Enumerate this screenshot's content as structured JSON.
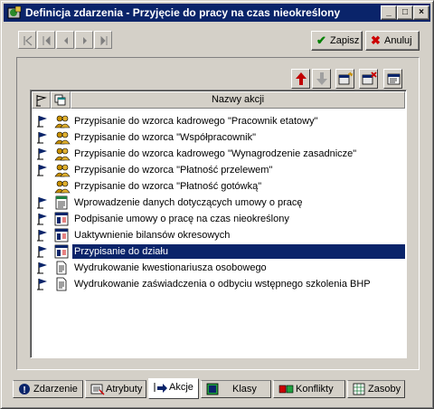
{
  "window": {
    "title": "Definicja zdarzenia - Przyjęcie do pracy na czas nieokreślony",
    "controls": [
      "_",
      "□",
      "×"
    ]
  },
  "toolbar": {
    "nav_buttons": [
      "first",
      "prev-page",
      "prev",
      "next",
      "last"
    ],
    "save_label": "Zapisz",
    "cancel_label": "Anuluj"
  },
  "list": {
    "column_header": "Nazwy akcji",
    "rows": [
      {
        "label": "Przypisanie do wzorca kadrowego \"Pracownik etatowy\"",
        "flag": true,
        "icon": "people-icon",
        "selected": false
      },
      {
        "label": "Przypisanie do wzorca \"Współpracownik\"",
        "flag": true,
        "icon": "people-icon",
        "selected": false
      },
      {
        "label": "Przypisanie do wzorca kadrowego \"Wynagrodzenie zasadnicze\"",
        "flag": true,
        "icon": "people-icon",
        "selected": false
      },
      {
        "label": "Przypisanie do wzorca \"Płatność przelewem\"",
        "flag": true,
        "icon": "people-icon",
        "selected": false
      },
      {
        "label": "Przypisanie do wzorca \"Płatność gotówką\"",
        "flag": false,
        "icon": "people-icon",
        "selected": false
      },
      {
        "label": "Wprowadzenie danych dotyczących umowy o pracę",
        "flag": true,
        "icon": "form-icon",
        "selected": false
      },
      {
        "label": "Podpisanie umowy o pracę na czas nieokreślony",
        "flag": true,
        "icon": "info-window-icon",
        "selected": false
      },
      {
        "label": "Uaktywnienie bilansów okresowych",
        "flag": true,
        "icon": "info-window-icon",
        "selected": false
      },
      {
        "label": "Przypisanie do działu",
        "flag": true,
        "icon": "info-window-icon",
        "selected": true
      },
      {
        "label": "Wydrukowanie kwestionariusza osobowego",
        "flag": true,
        "icon": "document-icon",
        "selected": false
      },
      {
        "label": "Wydrukowanie zaświadczenia o odbyciu wstępnego szkolenia BHP",
        "flag": true,
        "icon": "document-icon",
        "selected": false
      }
    ]
  },
  "tabs": [
    {
      "label": "Zdarzenie",
      "icon": "event-icon",
      "active": false
    },
    {
      "label": "Atrybuty",
      "icon": "attributes-icon",
      "active": false
    },
    {
      "label": "Akcje",
      "icon": "actions-icon",
      "active": true
    },
    {
      "label": "Klasy",
      "icon": "classes-icon",
      "active": false
    },
    {
      "label": "Konflikty",
      "icon": "conflicts-icon",
      "active": false
    },
    {
      "label": "Zasoby",
      "icon": "resources-icon",
      "active": false
    }
  ],
  "colors": {
    "title_bar": "#0a246a",
    "face": "#d4d0c8",
    "selection": "#0a246a",
    "save_check": "#008000",
    "cancel_x": "#cc0000"
  }
}
